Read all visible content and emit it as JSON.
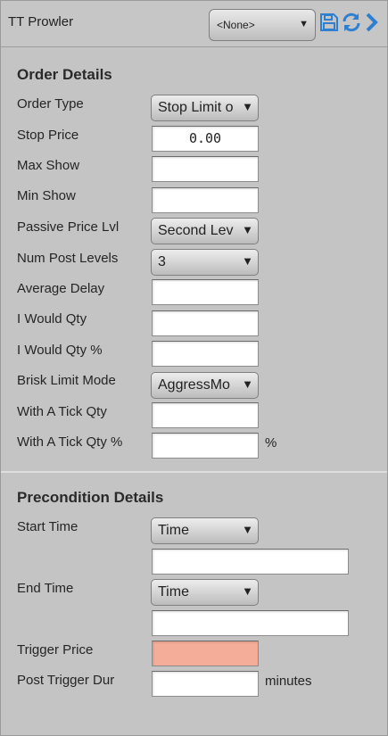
{
  "header": {
    "title": "TT Prowler",
    "preset_value": "<None>",
    "icons": [
      "save-icon",
      "refresh-icon",
      "chevron-right-icon"
    ],
    "icon_color": "#2f7fd0"
  },
  "order_details": {
    "title": "Order Details",
    "fields": {
      "order_type": {
        "label": "Order Type",
        "value": "Stop Limit o"
      },
      "stop_price": {
        "label": "Stop Price",
        "value": "0.00"
      },
      "max_show": {
        "label": "Max Show",
        "value": ""
      },
      "min_show": {
        "label": "Min Show",
        "value": ""
      },
      "passive_price_lvl": {
        "label": "Passive Price Lvl",
        "value": "Second Lev"
      },
      "num_post_levels": {
        "label": "Num Post Levels",
        "value": "3"
      },
      "average_delay": {
        "label": "Average Delay",
        "value": ""
      },
      "i_would_qty": {
        "label": "I Would Qty",
        "value": ""
      },
      "i_would_qty_pct": {
        "label": "I Would Qty %",
        "value": "",
        "unit": ""
      },
      "brisk_limit_mode": {
        "label": "Brisk Limit Mode",
        "value": "AggressMo"
      },
      "with_a_tick_qty": {
        "label": "With A Tick Qty",
        "value": ""
      },
      "with_a_tick_qty_pct": {
        "label": "With A Tick Qty %",
        "value": "",
        "unit": "%"
      }
    }
  },
  "precondition_details": {
    "title": "Precondition Details",
    "fields": {
      "start_time": {
        "label": "Start Time",
        "type_value": "Time",
        "value": ""
      },
      "end_time": {
        "label": "End Time",
        "type_value": "Time",
        "value": ""
      },
      "trigger_price": {
        "label": "Trigger Price",
        "value": ""
      },
      "post_trigger_dur": {
        "label": "Post Trigger Dur",
        "value": "",
        "unit": "minutes"
      }
    }
  },
  "colors": {
    "background": "#c4c4c4",
    "trigger_price_bg": "#f3ad99",
    "accent": "#2f7fd0"
  }
}
